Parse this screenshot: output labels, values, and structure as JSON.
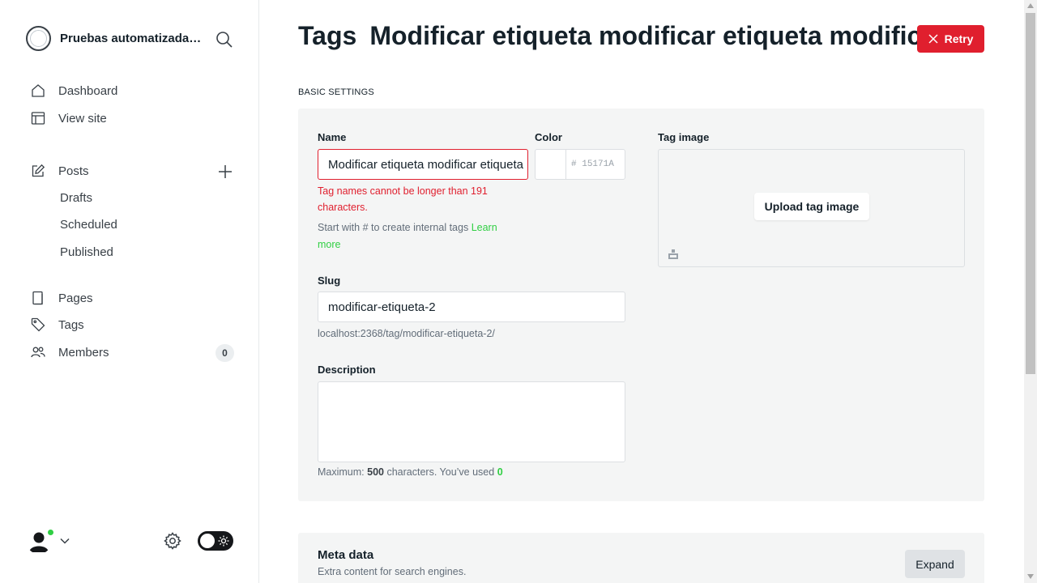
{
  "sidebar": {
    "site_title": "Pruebas automatizadas de software",
    "nav": {
      "dashboard": "Dashboard",
      "view_site": "View site",
      "posts": "Posts",
      "drafts": "Drafts",
      "scheduled": "Scheduled",
      "published": "Published",
      "pages": "Pages",
      "tags": "Tags",
      "members": "Members",
      "members_count": "0"
    }
  },
  "header": {
    "breadcrumb_root": "Tags",
    "title": "Modificar etiqueta modificar etiqueta modificar etiqueta",
    "retry_label": "Retry"
  },
  "form": {
    "section_title": "BASIC SETTINGS",
    "name_label": "Name",
    "name_value": "Modificar etiqueta modificar etiqueta modificar etiqueta",
    "name_error": "Tag names cannot be longer than 191 characters.",
    "name_hint": "Start with # to create internal tags",
    "name_hint_link": "Learn more",
    "color_label": "Color",
    "color_value": "15171A",
    "color_prefix": "#",
    "tag_image_label": "Tag image",
    "upload_label": "Upload tag image",
    "slug_label": "Slug",
    "slug_value": "modificar-etiqueta-2",
    "slug_url": "localhost:2368/tag/modificar-etiqueta-2/",
    "description_label": "Description",
    "description_value": "",
    "count_prefix": "Maximum:",
    "count_max": "500",
    "count_middle": "characters. You’ve used",
    "count_used": "0"
  },
  "meta": {
    "title": "Meta data",
    "subtitle": "Extra content for search engines.",
    "expand_label": "Expand"
  },
  "colors": {
    "accent": "#30cf43",
    "error": "#e01f2e",
    "text": "#15212a"
  }
}
